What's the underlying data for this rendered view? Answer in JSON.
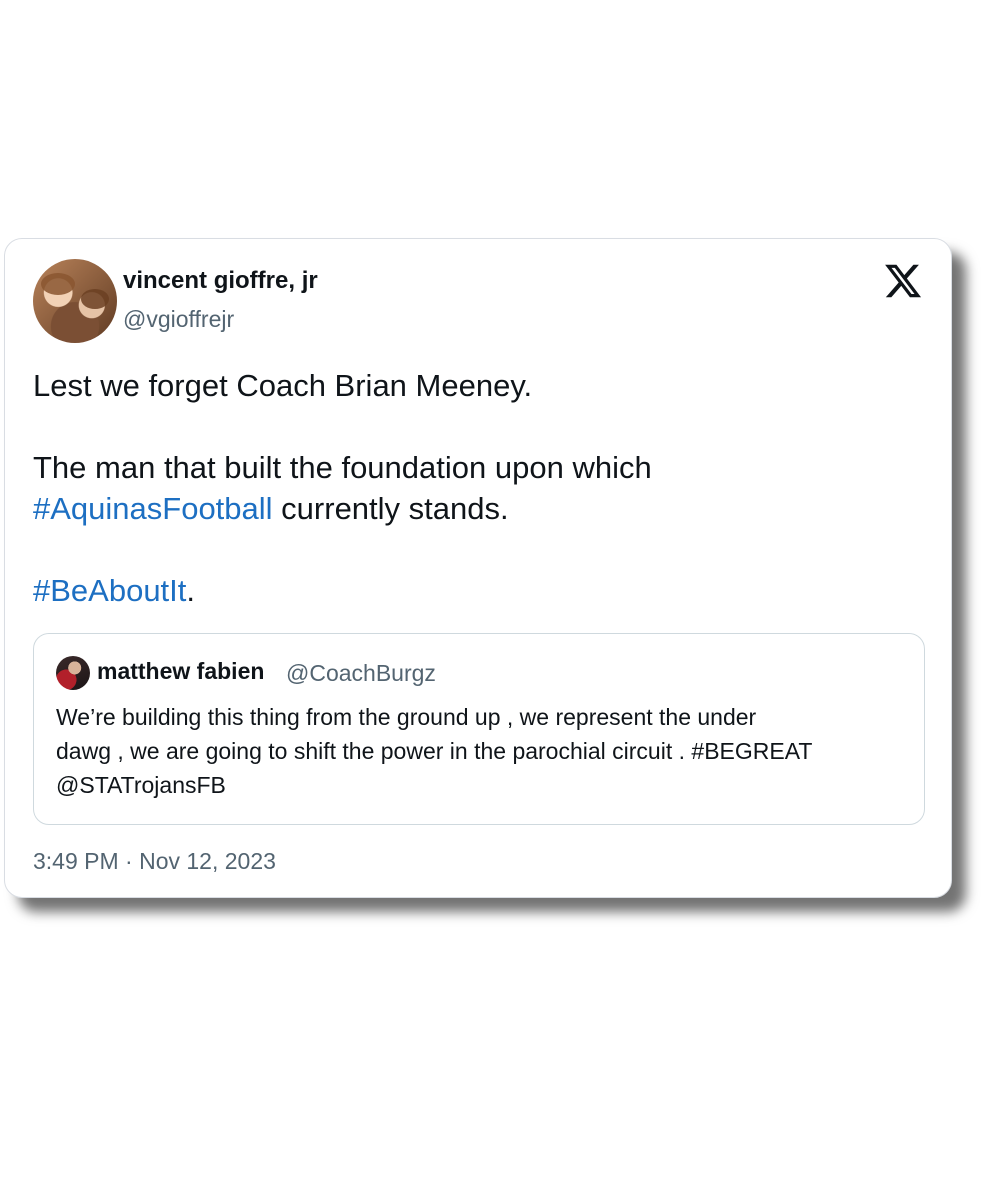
{
  "tweet": {
    "author": {
      "display_name": "vincent gioffre, jr",
      "handle": "@vgioffrejr"
    },
    "platform_icon": "x-logo-icon",
    "text": {
      "line1": "Lest we forget Coach Brian Meeney.",
      "line2": "The man that built the foundation upon which",
      "line3_hashtag": "#AquinasFootball",
      "line3_rest": " currently stands.",
      "line4_hashtag": "#BeAboutIt",
      "line4_rest": "."
    },
    "quote": {
      "display_name": "matthew fabien",
      "handle": "@CoachBurgz",
      "lines": [
        "We’re building this thing from the ground up , we represent the under",
        "dawg , we are going to shift the power in the parochial circuit . #BEGREAT",
        "@STATrojansFB"
      ]
    },
    "timestamp": "3:49 PM · Nov 12, 2023"
  },
  "colors": {
    "text": "#0f1419",
    "secondary": "#536471",
    "hashtag": "#1d6fc2",
    "border": "#cfd9de"
  }
}
